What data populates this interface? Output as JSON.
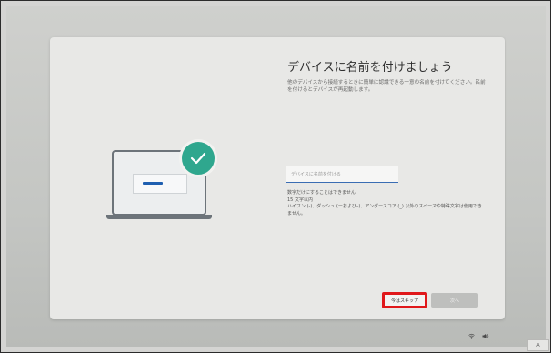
{
  "screen": {
    "title": "デバイスに名前を付けましょう",
    "description": "他のデバイスから接続するときに簡単に認識できる一意の名前を付けてください。名前を付けるとデバイスが再起動します。",
    "name_input": {
      "value": "",
      "placeholder": "デバイスに名前を付ける"
    },
    "rules": [
      "数字だけにすることはできません",
      "15 文字以内",
      "ハイフン (-)、ダッシュ (ーおよび–)、アンダースコア (_) 以外のスペースや特殊文字は使用できません。"
    ]
  },
  "buttons": {
    "skip_label": "今はスキップ",
    "next_label": "次へ"
  },
  "illustration": {
    "icons": [
      "laptop-icon",
      "checkmark-icon"
    ],
    "badge_color": "#2fa78e",
    "highlight_color": "#e0181b"
  },
  "tray": {
    "ime_label": "A"
  }
}
